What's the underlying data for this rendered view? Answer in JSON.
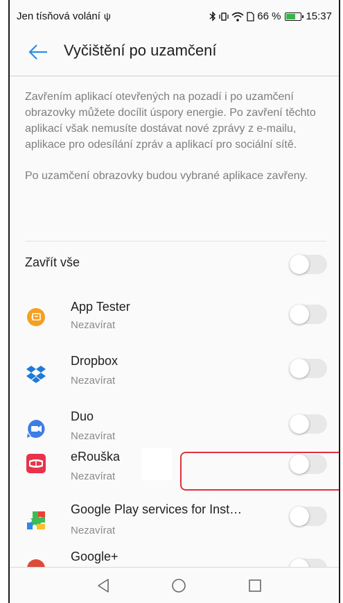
{
  "status_bar": {
    "carrier": "Jen tísňová volání",
    "battery_percent": "66 %",
    "time": "15:37",
    "battery_level": 0.66
  },
  "header": {
    "title": "Vyčištění po uzamčení"
  },
  "description": {
    "paragraph1": "Zavřením aplikací otevřených na pozadí i po uzamčení obrazovky můžete docílit úspory energie. Po zavření těchto aplikací však nemusíte dostávat nové zprávy z e-mailu, aplikace pro odesílání zpráv a aplikací pro sociální sítě.",
    "paragraph2": "Po uzamčení obrazovky budou vybrané aplikace zavřeny."
  },
  "close_all": {
    "label": "Zavřít vše",
    "enabled": false
  },
  "apps": [
    {
      "name": "App Tester",
      "status": "Nezavírat",
      "icon": "app-tester-icon",
      "enabled": false
    },
    {
      "name": "Dropbox",
      "status": "Nezavírat",
      "icon": "dropbox-icon",
      "enabled": false
    },
    {
      "name": "Duo",
      "status": "Nezavírat",
      "icon": "duo-icon",
      "enabled": false
    },
    {
      "name": "eRouška",
      "status": "Nezavírat",
      "icon": "erouska-icon",
      "enabled": false
    },
    {
      "name": "Google Play services for Inst…",
      "status": "Nezavírat",
      "icon": "google-play-services-icon",
      "enabled": false
    },
    {
      "name": "Google+",
      "status": "",
      "icon": "google-plus-icon",
      "enabled": false
    }
  ],
  "colors": {
    "accent": "#2b8ce3",
    "highlight": "#e0303a",
    "toggle_off": "#e8e8e8"
  }
}
